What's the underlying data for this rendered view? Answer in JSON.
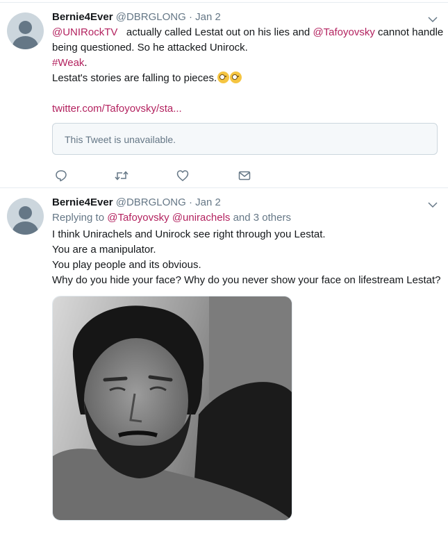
{
  "tweets": [
    {
      "display_name": "Bernie4Ever",
      "handle": "@DBRGLONG",
      "separator": "·",
      "date": "Jan 2",
      "mention_1": "@UNIRockTV",
      "text_1": "actually called Lestat out on his lies and",
      "mention_2": "@Tafoyovsky",
      "text_2": "cannot handle",
      "text_3": "being questioned. So he attacked Unirock.",
      "hashtag": "#Weak",
      "hashtag_suffix": ".",
      "text_4": "Lestat's stories are falling to pieces.",
      "emoji_names": [
        "face-with-monocle-emoji",
        "face-with-monocle-emoji"
      ],
      "quoted_link": "twitter.com/Tafoyovsky/sta...",
      "card_text": "This Tweet is unavailable.",
      "actions": [
        "reply-icon",
        "retweet-icon",
        "like-icon",
        "message-icon"
      ]
    },
    {
      "display_name": "Bernie4Ever",
      "handle": "@DBRGLONG",
      "separator": "·",
      "date": "Jan 2",
      "replying_prefix": "Replying to",
      "replying_mention_1": "@Tafoyovsky",
      "replying_mention_2": "@unirachels",
      "replying_suffix": "and 3 others",
      "lines": [
        "I think Unirachels and Unirock see right through you Lestat.",
        "You are a manipulator.",
        "You play people and its obvious.",
        "Why do you hide your face? Why do you never show your face on lifestream Lestat?"
      ],
      "media_description": "black-and-white photo of a bearded man"
    }
  ],
  "colors": {
    "link": "#b3225f",
    "secondary_text": "#657786",
    "divider": "#e6ecf0",
    "card_background": "#f5f8fa"
  }
}
